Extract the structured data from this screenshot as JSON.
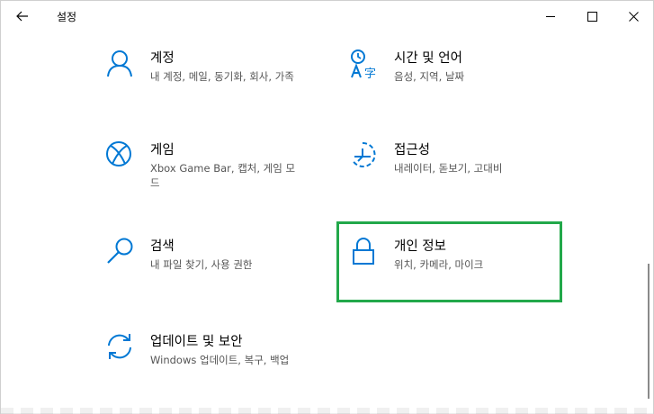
{
  "window": {
    "title": "설정"
  },
  "colors": {
    "accent": "#0078d4",
    "highlight": "#22a84a"
  },
  "tiles": [
    {
      "icon": "person-icon",
      "name": "계정",
      "desc": "내 계정, 메일, 동기화, 회사, 가족"
    },
    {
      "icon": "time-language-icon",
      "name": "시간 및 언어",
      "desc": "음성, 지역, 날짜"
    },
    {
      "icon": "xbox-icon",
      "name": "게임",
      "desc": "Xbox Game Bar, 캡처, 게임 모드"
    },
    {
      "icon": "ease-of-access-icon",
      "name": "접근성",
      "desc": "내레이터, 돋보기, 고대비"
    },
    {
      "icon": "search-icon",
      "name": "검색",
      "desc": "내 파일 찾기, 사용 권한"
    },
    {
      "icon": "lock-icon",
      "name": "개인 정보",
      "desc": "위치, 카메라, 마이크"
    },
    {
      "icon": "sync-icon",
      "name": "업데이트 및 보안",
      "desc": "Windows 업데이트, 복구, 백업"
    }
  ]
}
